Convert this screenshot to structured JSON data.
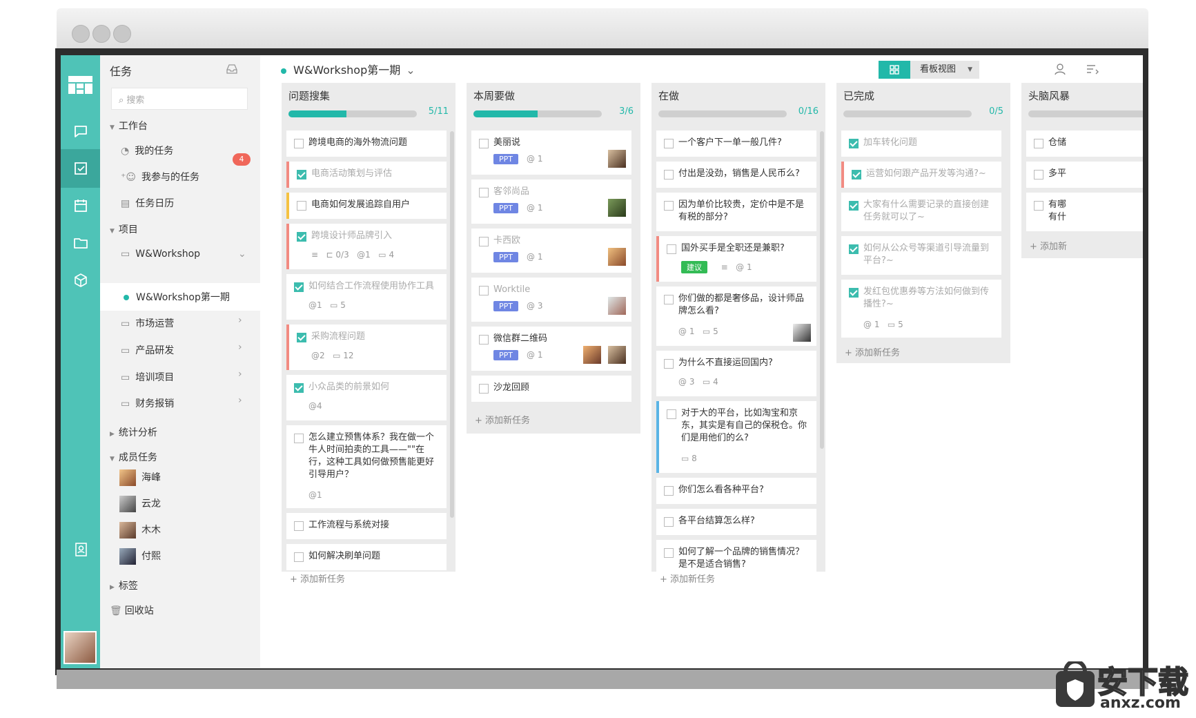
{
  "sidebar": {
    "title": "任务",
    "search_placeholder": "搜索",
    "workbench": "工作台",
    "my_tasks": "我的任务",
    "my_tasks_count": "4",
    "participated": "我参与的任务",
    "calendar": "任务日历",
    "projects": "项目",
    "proj_workshop": "W&Workshop",
    "proj_workshop_1": "W&Workshop第一期",
    "proj_market": "市场运营",
    "proj_product": "产品研发",
    "proj_training": "培训项目",
    "proj_finance": "财务报销",
    "stats": "统计分析",
    "members": "成员任务",
    "member_1": "海峰",
    "member_2": "云龙",
    "member_3": "木木",
    "member_4": "付熙",
    "tags": "标签",
    "trash": "回收站"
  },
  "header": {
    "project": "W&Workshop第一期",
    "view_label": "看板视图"
  },
  "columns": [
    {
      "title": "问题搜集",
      "count": "5/11",
      "progress": 0.45,
      "add": "添加新任务"
    },
    {
      "title": "本周要做",
      "count": "3/6",
      "progress": 0.5,
      "add": "添加新任务"
    },
    {
      "title": "在做",
      "count": "0/16",
      "progress": 0.0,
      "add": "添加新任务"
    },
    {
      "title": "已完成",
      "count": "0/5",
      "progress": 0.0,
      "add": "添加新任务"
    },
    {
      "title": "头脑风暴",
      "add": "添加新"
    }
  ],
  "c1": {
    "t1": "跨境电商的海外物流问题",
    "t2": "电商活动策划与评估",
    "t3": "电商如何发展追踪自用户",
    "t4": "跨境设计师品牌引入",
    "t4_meta": "0/3",
    "t4_at": "1",
    "t4_cm": "4",
    "t5": "如何结合工作流程使用协作工具",
    "t5_at": "1",
    "t5_cm": "5",
    "t6": "采购流程问题",
    "t6_at": "2",
    "t6_cm": "12",
    "t7": "小众品类的前景如何",
    "t7_at": "4",
    "t8": "怎么建立预售体系？我在做一个牛人时间拍卖的工具——\"\"在行，这种工具如何做预售能更好引导用户？",
    "t8_at": "1",
    "t9": "工作流程与系统对接",
    "t10": "如何解决刷单问题"
  },
  "c2": {
    "t1": "美丽说",
    "t2": "客邻尚品",
    "t3": "卡西欧",
    "t4": "Worktile",
    "t5": "微信群二维码",
    "t6": "沙龙回顾",
    "tag": "PPT",
    "a1": "1",
    "a2": "1",
    "a3": "1",
    "a4": "3",
    "a5": "1"
  },
  "c3": {
    "t1": "一个客户下一单一般几件?",
    "t2": "付出是没劲，销售是人民币么?",
    "t3": "因为单价比较贵，定价中是不是有税的部分?",
    "t4": "国外买手是全职还是兼职?",
    "t4_tag": "建议",
    "t4_at": "1",
    "t5": "你们做的都是奢侈品，设计师品牌怎么看?",
    "t5_at": "1",
    "t5_cm": "5",
    "t6": "为什么不直接运回国内?",
    "t6_at": "3",
    "t6_cm": "4",
    "t7": "对于大的平台，比如淘宝和京东，其实是有自己的保税仓。你们是用他们的么?",
    "t7_cm": "8",
    "t8": "你们怎么看各种平台?",
    "t9": "各平台结算怎么样?",
    "t10": "如何了解一个品牌的销售情况？是不是适合销售?"
  },
  "c4": {
    "t1": "加车转化问题",
    "t2": "运营如何跟产品开发等沟通?~",
    "t3": "大家有什么需要记录的直接创建任务就可以了~",
    "t4": "如何从公众号等渠道引导流量到平台?~",
    "t5": "发红包优惠券等方法如何做到传播性?~",
    "t5_at": "1",
    "t5_cm": "5"
  },
  "c5": {
    "t1": "仓储",
    "t2": "多平",
    "t3a": "有哪",
    "t3b": "有什"
  },
  "watermark": {
    "cn": "安下载",
    "en": "anxz.com"
  },
  "colors": {
    "accent": "#22b8a9",
    "rail": "#4fc3b7",
    "tag_ppt": "#6f86e3",
    "tag_green": "#33bb55",
    "badge": "#f0675a"
  }
}
